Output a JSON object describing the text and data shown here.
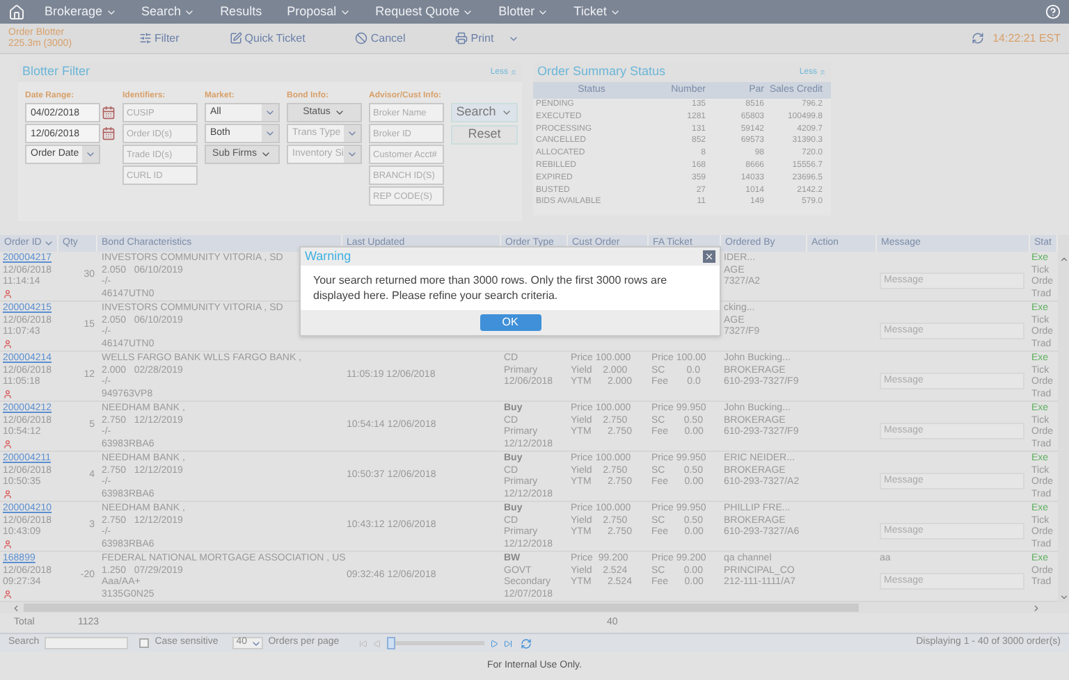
{
  "nav": {
    "items": [
      {
        "label": "Brokerage",
        "has_menu": true
      },
      {
        "label": "Search",
        "has_menu": true
      },
      {
        "label": "Results",
        "has_menu": false
      },
      {
        "label": "Proposal",
        "has_menu": true
      },
      {
        "label": "Request Quote",
        "has_menu": true
      },
      {
        "label": "Blotter",
        "has_menu": true
      },
      {
        "label": "Ticket",
        "has_menu": true
      }
    ]
  },
  "toolbar": {
    "title": "Order Blotter",
    "subtitle": "225.3m (3000)",
    "buttons": [
      {
        "label": "Filter",
        "kind": "filter",
        "has_menu": false
      },
      {
        "label": "Quick Ticket",
        "kind": "ticket",
        "has_menu": false
      },
      {
        "label": "Cancel",
        "kind": "cancel",
        "has_menu": false
      },
      {
        "label": "Print",
        "kind": "print",
        "has_menu": true
      }
    ],
    "time": "14:22:21 EST"
  },
  "filter": {
    "title": "Blotter Filter",
    "toggle": "Less",
    "groups": [
      {
        "label": "Date Range:",
        "controls": [
          {
            "kind": "date",
            "value": "04/02/2018"
          },
          {
            "kind": "date",
            "value": "12/06/2018"
          },
          {
            "kind": "select",
            "value": "Order Date"
          }
        ]
      },
      {
        "label": "Identifiers:",
        "controls": [
          {
            "kind": "input",
            "placeholder": "CUSIP"
          },
          {
            "kind": "input",
            "placeholder": "Order ID(s)"
          },
          {
            "kind": "input",
            "placeholder": "Trade ID(s)"
          },
          {
            "kind": "input",
            "placeholder": "CURL ID"
          }
        ]
      },
      {
        "label": "Market:",
        "controls": [
          {
            "kind": "select",
            "value": "All"
          },
          {
            "kind": "select",
            "value": "Both"
          },
          {
            "kind": "menu",
            "value": "Sub Firms"
          }
        ]
      },
      {
        "label": "Bond Info:",
        "controls": [
          {
            "kind": "menu",
            "value": "Status"
          },
          {
            "kind": "select",
            "placeholder": "Trans Type"
          },
          {
            "kind": "select",
            "placeholder": "Inventory Si"
          }
        ]
      },
      {
        "label": "Advisor/Cust Info:",
        "controls": [
          {
            "kind": "input",
            "placeholder": "Broker Name"
          },
          {
            "kind": "input",
            "placeholder": "Broker ID"
          },
          {
            "kind": "input",
            "placeholder": "Customer Acct#"
          },
          {
            "kind": "input",
            "placeholder": "BRANCH ID(S)"
          },
          {
            "kind": "input",
            "placeholder": "REP CODE(S)"
          }
        ]
      }
    ],
    "buttons": [
      {
        "label": "Search",
        "has_menu": true
      },
      {
        "label": "Reset",
        "has_menu": false
      }
    ]
  },
  "summary": {
    "title": "Order Summary Status",
    "toggle": "Less",
    "columns": [
      "Status",
      "Number",
      "Par",
      "Sales Credit"
    ],
    "rows": [
      [
        "PENDING",
        "135",
        "8516",
        "796.2"
      ],
      [
        "EXECUTED",
        "1281",
        "65803",
        "100499.8"
      ],
      [
        "PROCESSING",
        "131",
        "59142",
        "4209.7"
      ],
      [
        "CANCELLED",
        "852",
        "69573",
        "31390.3"
      ],
      [
        "ALLOCATED",
        "8",
        "98",
        "720.0"
      ],
      [
        "REBILLED",
        "168",
        "8666",
        "15556.7"
      ],
      [
        "EXPIRED",
        "359",
        "14033",
        "23696.5"
      ],
      [
        "BUSTED",
        "27",
        "1014",
        "2142.2"
      ],
      [
        "BIDS AVAILABLE",
        "11",
        "149",
        "579.0"
      ]
    ]
  },
  "table": {
    "columns": [
      {
        "label": "Order ID",
        "sortable": true
      },
      {
        "label": "Qty",
        "sortable": false
      },
      {
        "label": "Bond Characteristics",
        "sortable": false
      },
      {
        "label": "Last Updated",
        "sortable": false
      },
      {
        "label": "Order Type",
        "sortable": false
      },
      {
        "label": "Cust Order",
        "sortable": false
      },
      {
        "label": "FA Ticket",
        "sortable": false
      },
      {
        "label": "Ordered By",
        "sortable": false
      },
      {
        "label": "Action",
        "sortable": false
      },
      {
        "label": "Message",
        "sortable": false
      },
      {
        "label": "Stat",
        "sortable": false
      }
    ],
    "rows": [
      {
        "id": "200004217",
        "date": "12/06/2018",
        "time": "11:14:14",
        "qty": "30",
        "bond": [
          "INVESTORS COMMUNITY VITORIA , SD",
          "2.050   06/10/2019",
          "-/-",
          "46147UTN0"
        ],
        "ordered_by": [
          "IDER...",
          "AGE",
          "7327/A2"
        ],
        "message_placeholder": "Message",
        "status": [
          "Exe",
          "Tick",
          "Orde",
          "Trad"
        ]
      },
      {
        "id": "200004215",
        "date": "12/06/2018",
        "time": "11:07:43",
        "qty": "15",
        "bond": [
          "INVESTORS COMMUNITY VITORIA , SD",
          "2.050   06/10/2019",
          "-/-",
          "46147UTN0"
        ],
        "ordered_by": [
          "cking...",
          "AGE",
          "7327/F9"
        ],
        "message_placeholder": "Message",
        "status": [
          "Exe",
          "Tick",
          "Orde",
          "Trad"
        ]
      },
      {
        "id": "200004214",
        "date": "12/06/2018",
        "time": "11:05:18",
        "qty": "12",
        "bond": [
          "WELLS FARGO BANK WLLS FARGO BANK ,",
          "2.000   02/28/2019",
          "-/-",
          "949763VP8"
        ],
        "last_updated": "11:05:19 12/06/2018",
        "order_type": [
          "CD",
          "Primary",
          "12/06/2018"
        ],
        "cust_order": [
          "Price 100.000",
          "Yield    2.000",
          "YTM      2.000"
        ],
        "fa_ticket": [
          "Price 100.00",
          "SC        0.0",
          "Fee       0.0"
        ],
        "ordered_by": [
          "John Bucking...",
          "BROKERAGE",
          "610-293-7327/F9"
        ],
        "message_placeholder": "Message",
        "status": [
          "Exe",
          "Tick",
          "Orde",
          "Trad"
        ]
      },
      {
        "id": "200004212",
        "date": "12/06/2018",
        "time": "10:54:12",
        "qty": "5",
        "bond": [
          "NEEDHAM BANK ,",
          "2.750   12/12/2019",
          "-/-",
          "63983RBA6"
        ],
        "last_updated": "10:54:14 12/06/2018",
        "order_type": [
          "Buy",
          "CD",
          "Primary",
          "12/12/2018"
        ],
        "cust_order": [
          "Price 100.000",
          "Yield    2.750",
          "YTM      2.750"
        ],
        "fa_ticket": [
          "Price 99.950",
          "SC       0.50",
          "Fee      0.00"
        ],
        "ordered_by": [
          "John Bucking...",
          "BROKERAGE",
          "610-293-7327/F9"
        ],
        "message_placeholder": "Message",
        "status": [
          "Exe",
          "Tick",
          "Orde",
          "Trad"
        ]
      },
      {
        "id": "200004211",
        "date": "12/06/2018",
        "time": "10:50:35",
        "qty": "4",
        "bond": [
          "NEEDHAM BANK ,",
          "2.750   12/12/2019",
          "-/-",
          "63983RBA6"
        ],
        "last_updated": "10:50:37 12/06/2018",
        "order_type": [
          "Buy",
          "CD",
          "Primary",
          "12/12/2018"
        ],
        "cust_order": [
          "Price 100.000",
          "Yield    2.750",
          "YTM      2.750"
        ],
        "fa_ticket": [
          "Price 99.950",
          "SC       0.50",
          "Fee      0.00"
        ],
        "ordered_by": [
          "ERIC NEIDER...",
          "BROKERAGE",
          "610-293-7327/A2"
        ],
        "message_placeholder": "Message",
        "status": [
          "Exe",
          "Tick",
          "Orde",
          "Trad"
        ]
      },
      {
        "id": "200004210",
        "date": "12/06/2018",
        "time": "10:43:09",
        "qty": "3",
        "bond": [
          "NEEDHAM BANK ,",
          "2.750   12/12/2019",
          "-/-",
          "63983RBA6"
        ],
        "last_updated": "10:43:12 12/06/2018",
        "order_type": [
          "Buy",
          "CD",
          "Primary",
          "12/12/2018"
        ],
        "cust_order": [
          "Price 100.000",
          "Yield    2.750",
          "YTM      2.750"
        ],
        "fa_ticket": [
          "Price 99.950",
          "SC       0.50",
          "Fee      0.00"
        ],
        "ordered_by": [
          "PHILLIP FRE...",
          "BROKERAGE",
          "610-293-7327/A6"
        ],
        "message_placeholder": "Message",
        "status": [
          "Exe",
          "Tick",
          "Orde",
          "Trad"
        ]
      },
      {
        "id": "168899",
        "date": "12/06/2018",
        "time": "09:27:34",
        "qty": "-20",
        "bond": [
          "FEDERAL NATIONAL MORTGAGE ASSOCIATION , US",
          "1.250   07/29/2019",
          "Aaa/AA+",
          "3135G0N25"
        ],
        "last_updated": "09:32:46 12/06/2018",
        "order_type": [
          "BW",
          "GOVT",
          "Secondary",
          "12/07/2018"
        ],
        "cust_order": [
          "Price  99.200",
          "Yield    2.524",
          "YTM      2.524"
        ],
        "fa_ticket": [
          "Price 99.200",
          "SC       0.00",
          "Fee      0.00"
        ],
        "ordered_by": [
          "qa channel",
          "PRINCIPAL_CO",
          "212-111-1111/A7"
        ],
        "message_text": "aa",
        "message_placeholder": "Message",
        "status": [
          "Exe",
          "Orde",
          "Trad"
        ]
      }
    ],
    "totals": {
      "label": "Total",
      "qty": "1123",
      "count": "40"
    }
  },
  "footer": {
    "search_label": "Search",
    "case_sensitive": {
      "label": "Case sensitive",
      "checked": false
    },
    "per_page": {
      "value": "40",
      "label": "Orders per page"
    },
    "pager": {
      "level": 0
    },
    "display": "Displaying 1 - 40 of 3000 order(s)"
  },
  "notice": "For Internal Use Only.",
  "dialog": {
    "title": "Warning",
    "message": "Your search returned more than 3000 rows. Only the first 3000 rows are displayed here. Please refine your search criteria.",
    "button": "OK"
  }
}
